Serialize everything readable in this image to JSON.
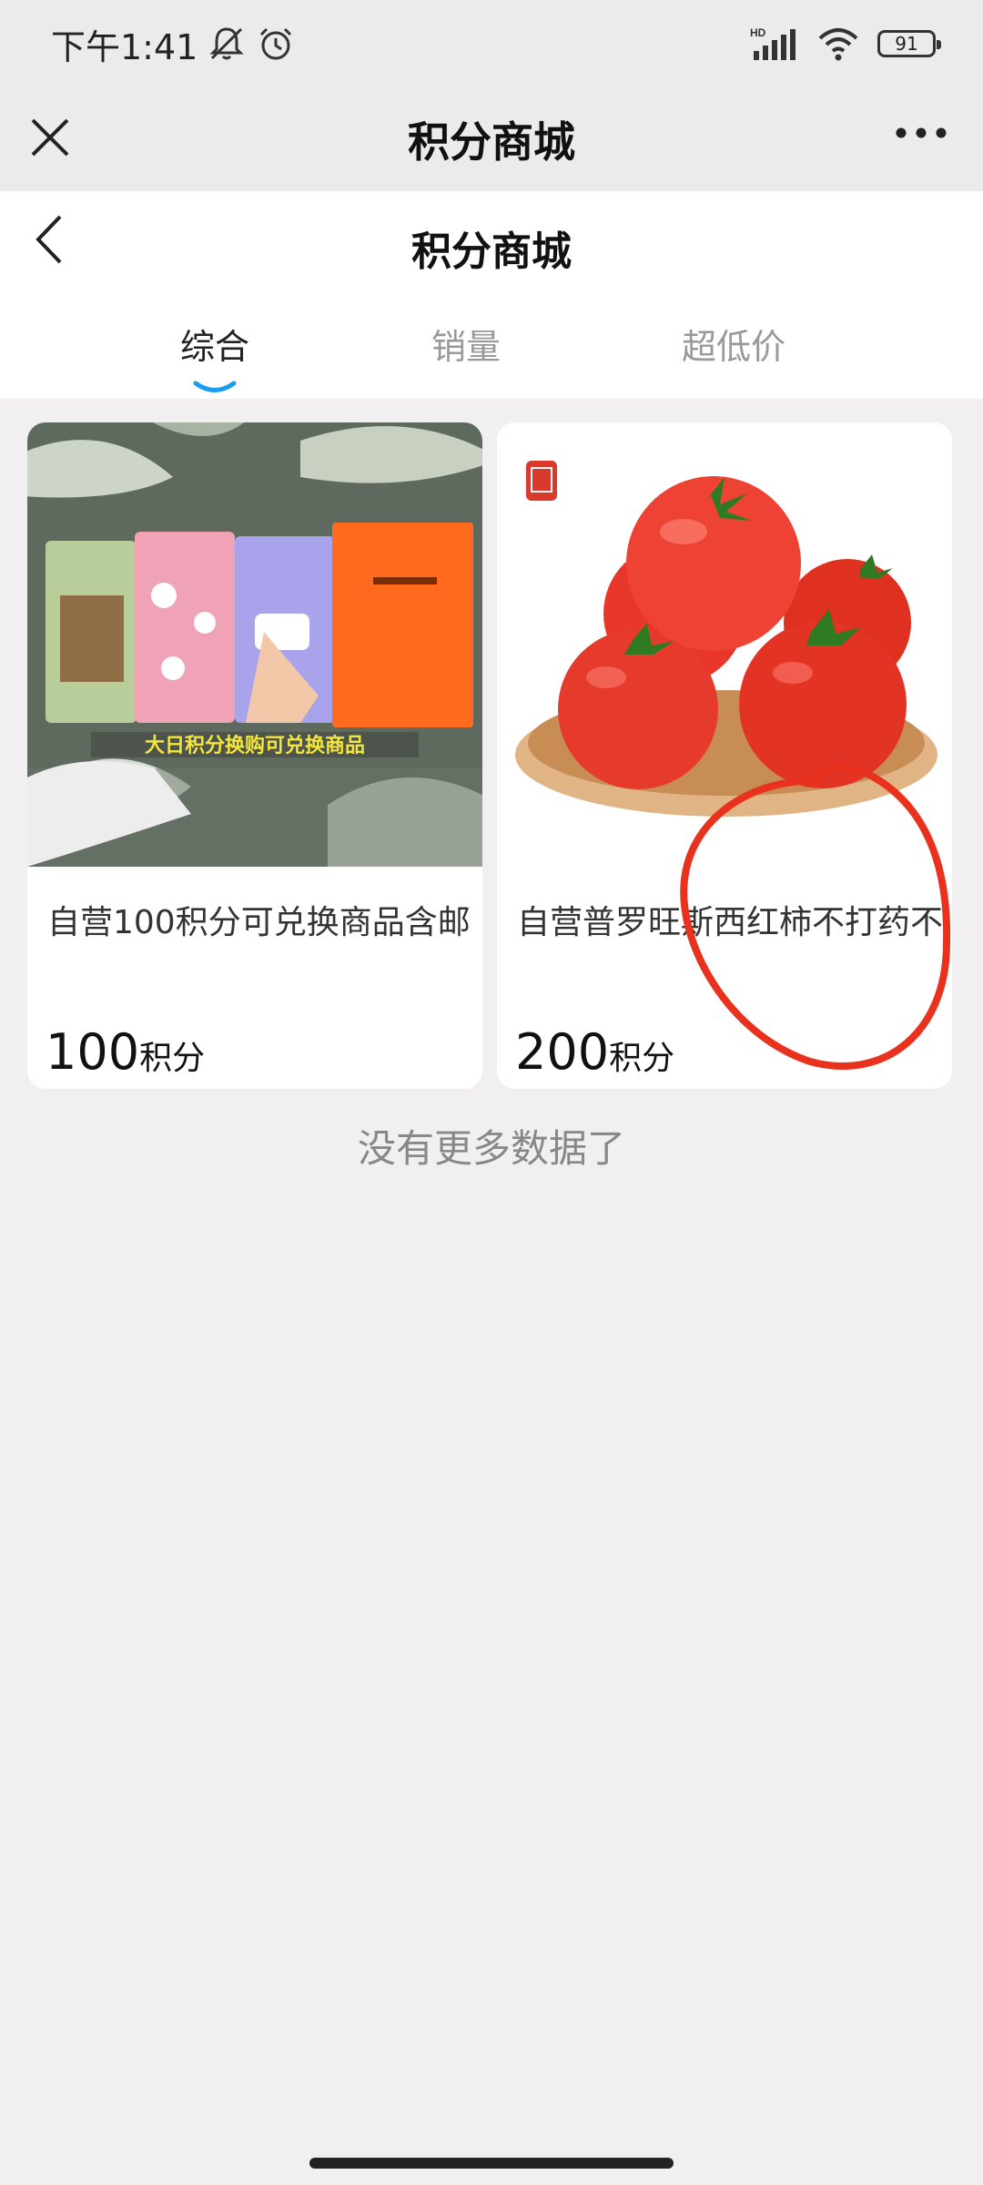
{
  "status_bar": {
    "time": "下午1:41",
    "network": "HD",
    "battery": "91",
    "icons": [
      "mute-icon",
      "alarm-icon",
      "signal-icon",
      "wifi-icon",
      "battery-icon"
    ]
  },
  "app_header": {
    "title": "积分商城",
    "close_icon": "close-icon",
    "more_icon": "more-icon"
  },
  "page": {
    "title": "积分商城",
    "back_icon": "chevron-left-icon",
    "tabs": [
      {
        "label": "综合",
        "active": true
      },
      {
        "label": "销量",
        "active": false
      },
      {
        "label": "超低价",
        "active": false
      }
    ]
  },
  "products": [
    {
      "name": "自营100积分可兑换商品含邮",
      "price": "100",
      "unit": "积分",
      "image_text": "大日积分换购可兑换商品"
    },
    {
      "name": "自营普罗旺斯西红柿不打药不",
      "price": "200",
      "unit": "积分"
    }
  ],
  "footer_text": "没有更多数据了",
  "colors": {
    "accent": "#1a9cf0",
    "annotation": "#e8321e",
    "background": "#f1efef"
  }
}
